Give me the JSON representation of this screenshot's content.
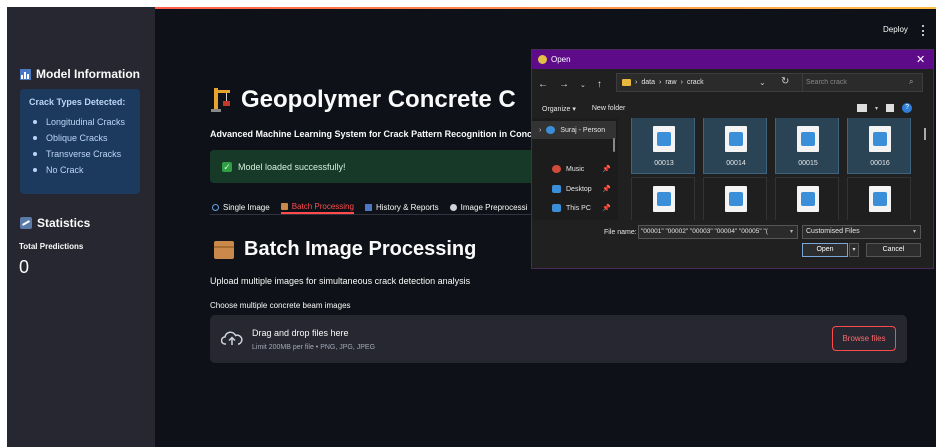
{
  "header": {
    "deploy_label": "Deploy"
  },
  "sidebar": {
    "model_info_title": "Model Information",
    "crack_types_title": "Crack Types Detected:",
    "crack_types": [
      "Longitudinal Cracks",
      "Oblique Cracks",
      "Transverse Cracks",
      "No Crack"
    ],
    "statistics_title": "Statistics",
    "total_predictions_label": "Total Predictions",
    "total_predictions_value": "0"
  },
  "main": {
    "title": "Geopolymer Concrete C",
    "subtitle": "Advanced Machine Learning System for Crack Pattern Recognition in Concret",
    "success_message": "Model loaded successfully!",
    "tabs": [
      {
        "label": "Single Image",
        "active": false
      },
      {
        "label": "Batch Processing",
        "active": true
      },
      {
        "label": "History & Reports",
        "active": false
      },
      {
        "label": "Image Preprocessi",
        "active": false
      }
    ],
    "section_title": "Batch Image Processing",
    "section_description": "Upload multiple images for simultaneous crack detection analysis",
    "uploader_label": "Choose multiple concrete beam images",
    "dropzone_main": "Drag and drop files here",
    "dropzone_sub": "Limit 200MB per file • PNG, JPG, JPEG",
    "browse_label": "Browse files"
  },
  "dialog": {
    "title": "Open",
    "breadcrumb": [
      "data",
      "raw",
      "crack"
    ],
    "search_placeholder": "Search crack",
    "organize_label": "Organize ▾",
    "new_folder_label": "New folder",
    "nav_items": [
      "Suraj - Person",
      "Music",
      "Desktop",
      "This PC"
    ],
    "files_row1": [
      "00013",
      "00014",
      "00015",
      "00016"
    ],
    "file_name_label": "File name:",
    "file_name_value": "\"00001\" \"00002\" \"00003\" \"00004\" \"00005\" \"(",
    "file_type_value": "Customised Files",
    "open_label": "Open",
    "cancel_label": "Cancel"
  },
  "colors": {
    "accent": "#ff4b4b",
    "background": "#0e1117",
    "sidebar": "#262730",
    "dialog_titlebar": "#5e0b8a"
  }
}
